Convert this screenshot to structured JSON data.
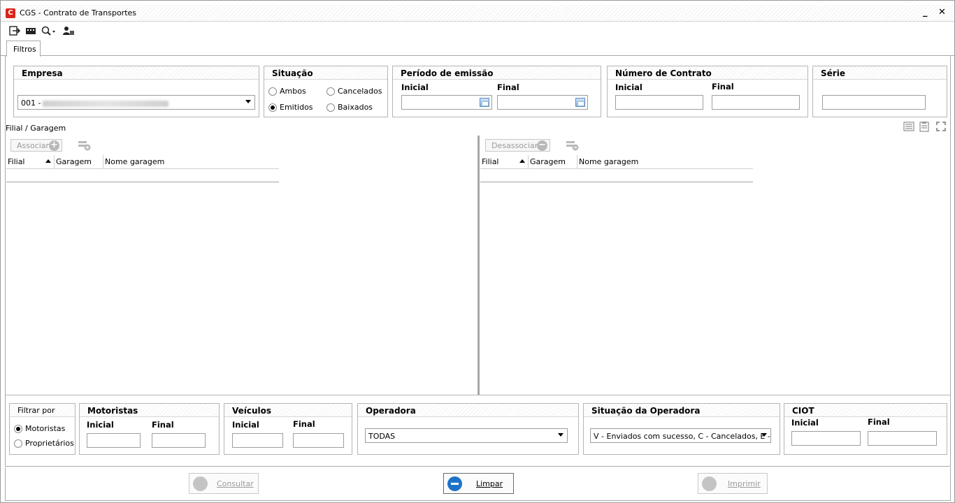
{
  "window": {
    "title": "CGS - Contrato de Transportes",
    "minimize": "_",
    "close": "✕"
  },
  "tabs": {
    "filtros": "Filtros"
  },
  "empresa": {
    "title": "Empresa",
    "value": "001 -"
  },
  "situacao": {
    "title": "Situação",
    "options": {
      "ambos": "Ambos",
      "cancelados": "Cancelados",
      "emitidos": "Emitidos",
      "baixados": "Baixados"
    },
    "selected": "emitidos"
  },
  "periodo": {
    "title": "Período de emissão",
    "inicial": "Inicial",
    "final": "Final"
  },
  "numero_contrato": {
    "title": "Número de Contrato",
    "inicial": "Inicial",
    "final": "Final"
  },
  "serie": {
    "title": "Série"
  },
  "filial_garagem": {
    "caption": "Filial / Garagem"
  },
  "left_grid": {
    "button": "Associar",
    "cols": [
      "Filial",
      "Garagem",
      "Nome garagem"
    ]
  },
  "right_grid": {
    "button": "Desassociar",
    "cols": [
      "Filial",
      "Garagem",
      "Nome garagem"
    ]
  },
  "filtrar_por": {
    "title": "Filtrar por",
    "motoristas": "Motoristas",
    "proprietarios": "Proprietários",
    "selected": "motoristas"
  },
  "motoristas": {
    "title": "Motoristas",
    "inicial": "Inicial",
    "final": "Final"
  },
  "veiculos": {
    "title": "Veículos",
    "inicial": "Inicial",
    "final": "Final"
  },
  "operadora": {
    "title": "Operadora",
    "value": "TODAS"
  },
  "situacao_operadora": {
    "title": "Situação da Operadora",
    "value": "V - Enviados com sucesso, C - Cancelados, E -..."
  },
  "ciot": {
    "title": "CIOT",
    "inicial": "Inicial",
    "final": "Final"
  },
  "buttons": {
    "consultar": "Consultar",
    "limpar": "Limpar",
    "imprimir": "Imprimir"
  }
}
